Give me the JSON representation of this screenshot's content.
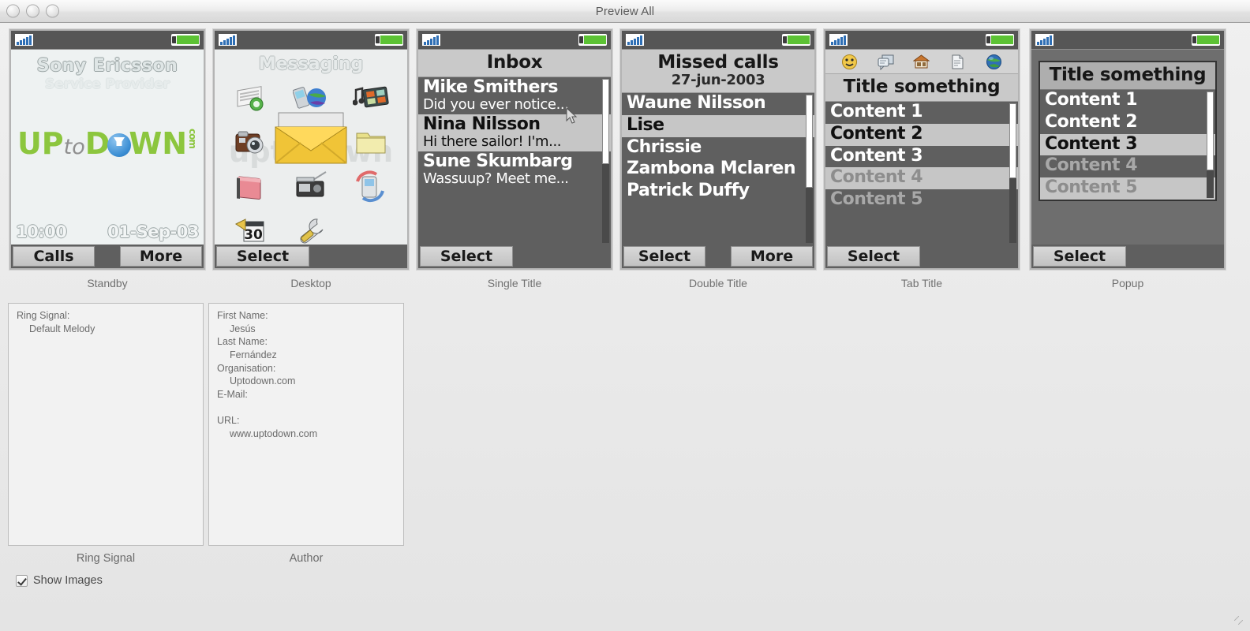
{
  "window": {
    "title": "Preview All",
    "controls": [
      "close",
      "minimize",
      "zoom"
    ]
  },
  "panels": [
    {
      "label": "Standby",
      "type": "standby",
      "brand": "Sony Ericsson",
      "provider": "Service Provider",
      "logo": {
        "part1": "UP",
        "part2": "to",
        "part3": "D",
        "part4": "WN",
        "suffix": "com"
      },
      "time": "10:00",
      "date": "01-Sep-03",
      "softkeys": {
        "left": "Calls",
        "right": "More"
      }
    },
    {
      "label": "Desktop",
      "type": "desktop",
      "title": "Messaging",
      "watermark": "uptodown",
      "icons": [
        "contacts-icon",
        "connectivity-icon",
        "entertainment-icon",
        "camera-icon",
        "music-icon",
        "folder-icon",
        "notes-icon",
        "radio-icon",
        "sync-icon",
        "calendar-icon",
        "settings-icon",
        "messaging-icon"
      ],
      "center_icon": "envelope-icon",
      "softkeys": {
        "single": "Select"
      }
    },
    {
      "label": "Single Title",
      "type": "list",
      "title": "Inbox",
      "rows": [
        {
          "line1": "Mike Smithers",
          "line2": "Did you ever notice...",
          "style": "dark"
        },
        {
          "line1": "Nina Nilsson",
          "line2": "Hi there sailor! I'm...",
          "style": "light"
        },
        {
          "line1": "Sune Skumbarg",
          "line2": "Wassuup?  Meet me...",
          "style": "dark"
        }
      ],
      "cursor": true,
      "softkeys": {
        "single": "Select"
      }
    },
    {
      "label": "Double Title",
      "type": "list",
      "title": "Missed calls",
      "subtitle": "27-jun-2003",
      "rows": [
        {
          "line1": "Waune Nilsson",
          "style": "dark"
        },
        {
          "line1": "Lise",
          "style": "light"
        },
        {
          "line1": "Chrissie",
          "style": "dark"
        },
        {
          "line1": "Zambona Mclaren",
          "style": "dark"
        },
        {
          "line1": "Patrick Duffy",
          "style": "dark"
        }
      ],
      "softkeys": {
        "left": "Select",
        "right": "More"
      }
    },
    {
      "label": "Tab Title",
      "type": "tab",
      "title": "Title something",
      "tabs": [
        "smiley-icon",
        "speech-bubble-icon",
        "house-icon",
        "document-icon",
        "globe-icon"
      ],
      "rows": [
        {
          "line1": "Content 1",
          "style": "dark"
        },
        {
          "line1": "Content 2",
          "style": "light"
        },
        {
          "line1": "Content 3",
          "style": "dark"
        },
        {
          "line1": "Content 4",
          "style": "light",
          "dim": true
        },
        {
          "line1": "Content 5",
          "style": "dark",
          "dim": true
        }
      ],
      "softkeys": {
        "single": "Select"
      }
    },
    {
      "label": "Popup",
      "type": "popup",
      "title": "Title something",
      "rows": [
        {
          "line1": "Content 1",
          "style": "dark"
        },
        {
          "line1": "Content 2",
          "style": "dark"
        },
        {
          "line1": "Content 3",
          "style": "light"
        },
        {
          "line1": "Content 4",
          "style": "dark",
          "dim": true
        },
        {
          "line1": "Content 5",
          "style": "light",
          "dim": true
        }
      ],
      "softkeys": {
        "single": "Select"
      }
    }
  ],
  "ring_signal": {
    "label": "Ring Signal",
    "lines": [
      {
        "text": "Ring Signal:",
        "indent": false
      },
      {
        "text": "Default Melody",
        "indent": true
      }
    ]
  },
  "author": {
    "label": "Author",
    "lines": [
      {
        "text": "First Name:",
        "indent": false
      },
      {
        "text": "Jesús",
        "indent": true
      },
      {
        "text": "Last Name:",
        "indent": false
      },
      {
        "text": "Fernández",
        "indent": true
      },
      {
        "text": "Organisation:",
        "indent": false
      },
      {
        "text": "Uptodown.com",
        "indent": true
      },
      {
        "text": "E-Mail:",
        "indent": false
      },
      {
        "text": " ",
        "indent": false
      },
      {
        "text": "URL:",
        "indent": false
      },
      {
        "text": "www.uptodown.com",
        "indent": true
      }
    ]
  },
  "show_images": {
    "label": "Show Images",
    "checked": true
  },
  "colors": {
    "status_bar": "#565656",
    "signal": "#2f6fb5",
    "battery": "#5cc234",
    "list_dark": "#5f5f5f",
    "list_light": "#c6c6c6",
    "title_lcd": "#c9c9c9",
    "logo_green": "#8cc63e",
    "logo_blue": "#3c8fd4"
  }
}
